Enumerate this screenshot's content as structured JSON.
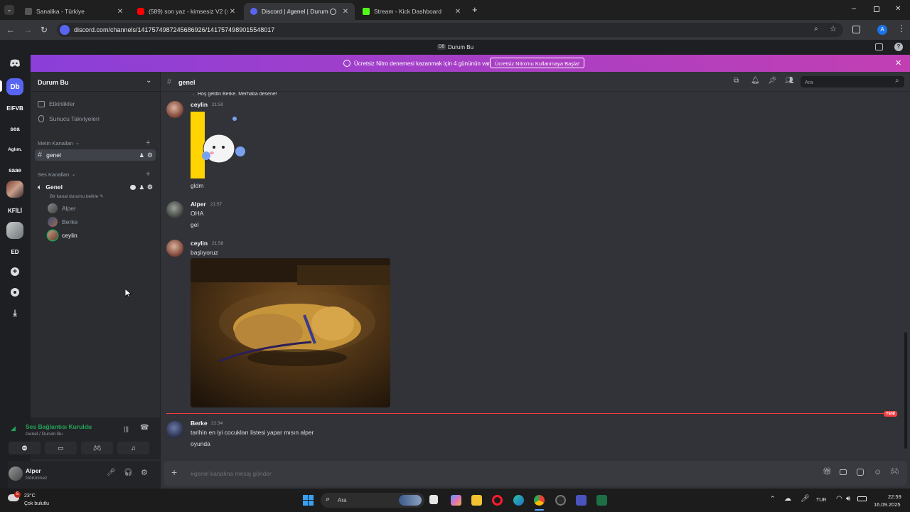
{
  "browser": {
    "tabs": [
      {
        "title": "Sanalika - Türkiye",
        "active": false,
        "favicon_color": "#3a3a3a"
      },
      {
        "title": "(589) son yaz - kimsesiz V2 (slo",
        "active": false,
        "favicon_color": "#ff0000"
      },
      {
        "title": "Discord | #genel | Durum Bu",
        "active": true,
        "favicon_color": "#5865f2"
      },
      {
        "title": "Stream - Kick Dashboard",
        "active": false,
        "favicon_color": "#53fc18"
      }
    ],
    "url": "discord.com/channels/1417574987245686926/1417574989015548017",
    "profile_initial": "A"
  },
  "discord": {
    "window_title": "Durum Bu",
    "window_badge": "DB",
    "nitro_banner": {
      "text": "Ücretsiz Nitro denemesi kazanmak için 4 gününün var",
      "button": "Ücretsiz Nitro'nu Kullanmaya Başla!"
    },
    "servers": [
      {
        "label": "Db",
        "color": "#5865f2"
      },
      {
        "label": "EIFVB",
        "color": "#2b2d31"
      },
      {
        "label": "sea",
        "color": "#2b2d31"
      },
      {
        "label": "Aglım.",
        "color": "#2b2d31"
      },
      {
        "label": "saae",
        "color": "#2b2d31"
      },
      {
        "label": "",
        "color": "#8a5a4a"
      },
      {
        "label": "KFİLİ",
        "color": "#2b2d31"
      },
      {
        "label": "",
        "color": "#9aa0a0"
      },
      {
        "label": "ED",
        "color": "#2b2d31"
      }
    ],
    "sidebar": {
      "server_name": "Durum Bu",
      "events": "Etkinlikler",
      "boosts": "Sunucu Takviyeleri",
      "text_category": "Metin Kanalları",
      "text_channel": "genel",
      "voice_category": "Ses Kanalları",
      "voice_channel": "Genel",
      "voice_status": "Bir kanal durumu belirle",
      "voice_users": [
        "Alper",
        "Berke",
        "ceylin"
      ]
    },
    "voice_panel": {
      "status": "Ses Bağlantısı Kuruldu",
      "location": "Genel / Durum Bu"
    },
    "user_panel": {
      "name": "Alper",
      "status": "Görünmez"
    },
    "chat": {
      "channel": "genel",
      "search_placeholder": "Ara",
      "system_message": "Hoş geldin Berke. Merhaba desene!",
      "messages": [
        {
          "author": "ceylin",
          "time": "21:50",
          "text": "gldm"
        },
        {
          "author": "Alper",
          "time": "21:57",
          "lines": [
            "OHA",
            "gel"
          ]
        },
        {
          "author": "ceylin",
          "time": "21:58",
          "text": "başlıyoruz"
        },
        {
          "author": "Berke",
          "time": "22:34",
          "lines": [
            "tarihin en iyi cocukları listesi yapar mısın alper",
            "oyunda"
          ]
        }
      ],
      "new_badge": "YENİ",
      "input_placeholder": "#genel kanalına mesaj gönder"
    }
  },
  "taskbar": {
    "weather_temp": "23°C",
    "weather_desc": "Çok bulutlu",
    "weather_badge": "5",
    "search": "Ara",
    "lang": "TUR",
    "time": "22:59",
    "date": "16.09.2025"
  }
}
